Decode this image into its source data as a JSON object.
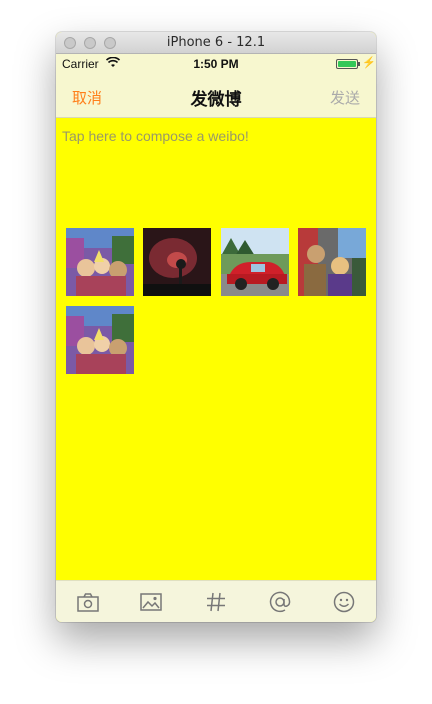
{
  "window": {
    "title": "iPhone 6 - 12.1"
  },
  "status_bar": {
    "carrier": "Carrier",
    "time": "1:50 PM"
  },
  "nav": {
    "cancel": "取消",
    "title": "发微博",
    "send": "发送"
  },
  "compose": {
    "placeholder": "Tap here to compose a weibo!"
  },
  "photos": [
    {
      "name": "photo-1",
      "subject": "animated party crowd"
    },
    {
      "name": "photo-2",
      "subject": "dark red scene with figure"
    },
    {
      "name": "photo-3",
      "subject": "red car on road"
    },
    {
      "name": "photo-4",
      "subject": "animated character group"
    },
    {
      "name": "photo-5",
      "subject": "animated party crowd"
    }
  ],
  "toolbar": [
    "camera-icon",
    "image-icon",
    "hashtag-icon",
    "mention-icon",
    "emoji-icon"
  ],
  "colors": {
    "background": "#ffff00",
    "bars": "#f7f7cf",
    "cancel": "#ff7f1a",
    "send": "#aaaaaa"
  }
}
